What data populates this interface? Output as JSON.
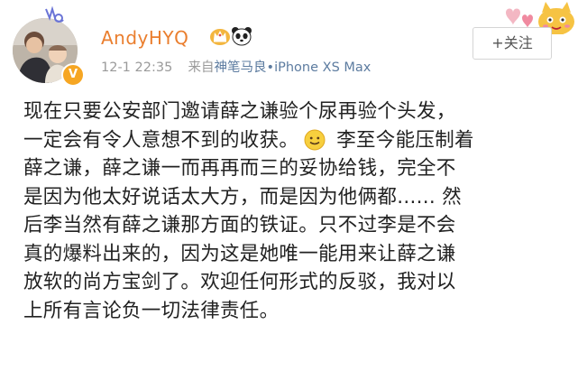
{
  "post": {
    "username": "AndyHYQ",
    "timestamp": "12-1 22:35",
    "source_prefix": "来自",
    "source": "神笔马良•iPhone XS Max",
    "follow_label": "+关注",
    "content": {
      "line1": "现在只要公安部门邀请薛之谦验个尿再验个头发，",
      "line2a": "一定会有令人意想不到的收获。",
      "line2b": "李至今能压制着",
      "line3": "薛之谦，薛之谦一而再再而三的妥协给钱，完全不",
      "line4": "是因为他太好说话太大方，而是因为他俩都...... 然",
      "line5": "后李当然有薛之谦那方面的铁证。只不过李是不会",
      "line6": "真的爆料出来的，因为这是她唯一能用来让薛之谦",
      "line7": "放软的尚方宝剑了。欢迎任何形式的反驳，我对以",
      "line8": "上所有言论负一切法律责任。"
    }
  },
  "icons": {
    "verified": "V",
    "emoji": "smile-emoji"
  },
  "colors": {
    "username": "#ea7e2e",
    "meta": "#9a9a9a",
    "source": "#5d7ca0",
    "text": "#222222",
    "badge": "#f6a623"
  }
}
